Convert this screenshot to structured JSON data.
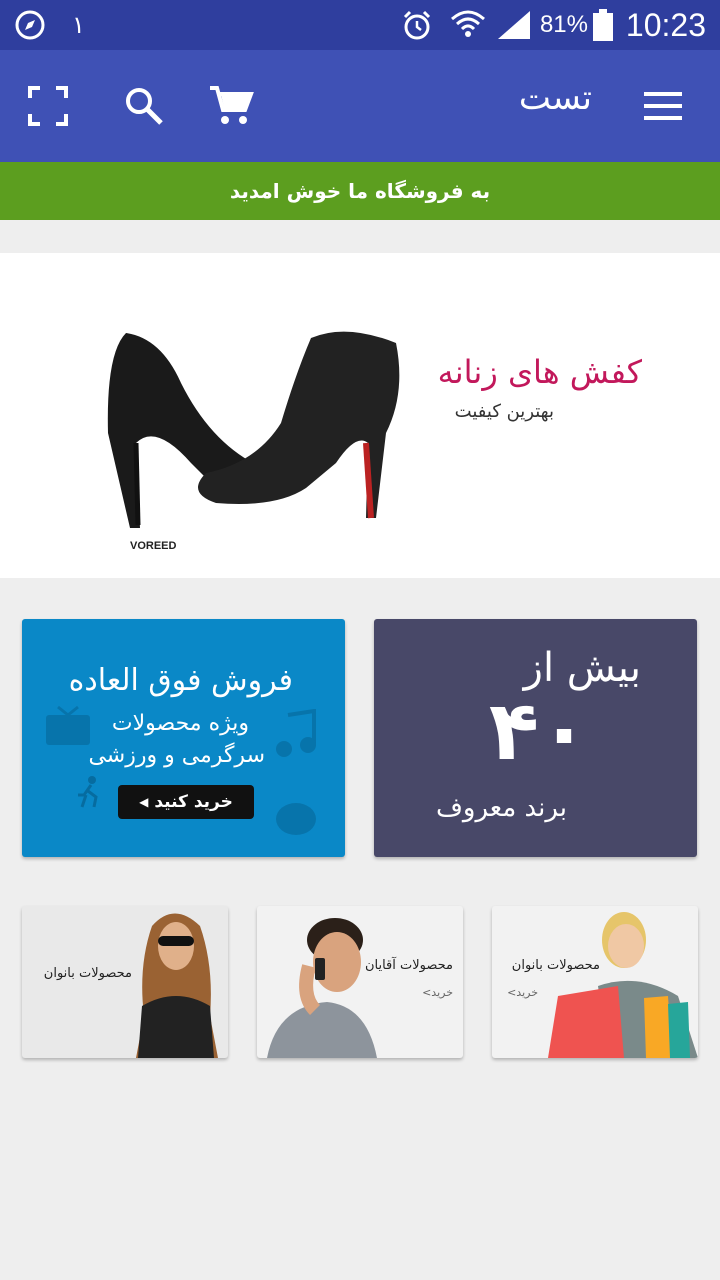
{
  "status_bar": {
    "time": "10:23",
    "battery_percent": "81%",
    "notification_count": "۱"
  },
  "app_bar": {
    "title": "تست",
    "icons": [
      "menu-icon",
      "cart-icon",
      "search-icon",
      "fullscreen-icon"
    ]
  },
  "welcome_banner": {
    "text": "به فروشگاه ما خوش امدید",
    "color": "#5c9e1f"
  },
  "hero": {
    "headline": "کفش های زنانه",
    "subtitle": "بهترین کیفیت",
    "brand": "VOREED",
    "headline_color": "#c2185b"
  },
  "promo_left": {
    "line1": "فروش فوق العاده",
    "line2": "ویژه محصولات",
    "line3": "سرگرمی و ورزشی",
    "button": "خرید کنید",
    "color": "#0a88c7"
  },
  "promo_right": {
    "top": "بیش از",
    "number": "۴۰",
    "bottom": "برند معروف",
    "color": "#484868"
  },
  "thumbnails": [
    {
      "label": "محصولات بانوان",
      "buy": ""
    },
    {
      "label": "محصولات آقایان",
      "buy": "خرید>"
    },
    {
      "label": "محصولات بانوان",
      "buy": "خرید>"
    }
  ],
  "colors": {
    "status_bar": "#2f3e9e",
    "app_bar": "#3f51b5",
    "background": "#eeeeee"
  }
}
